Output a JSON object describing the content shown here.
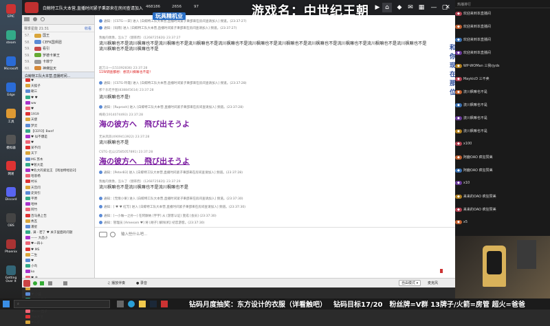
{
  "titlebar": {
    "title": "白鲸特工队大本营,直播时间紧子秉邵来在房间查请加入",
    "likes": "468186",
    "viewers": "2656",
    "extra": "97"
  },
  "overlay_title": "游戏名：中世纪王朝",
  "overlay_banner": "玩具精机业",
  "sidebar": {
    "header": "赛季星能 21:31",
    "header_link": "收看",
    "ranks": [
      {
        "n": "57.",
        "name": "国王"
      },
      {
        "n": "58.",
        "name": "CEFK国师团"
      },
      {
        "n": "59.",
        "name": "看引"
      },
      {
        "n": "59.",
        "name": "罗德卡莱王"
      },
      {
        "n": "59.",
        "name": "卡菲宁"
      },
      {
        "n": "60.",
        "name": "神佛监天"
      }
    ],
    "group": "白鲸特工队大本营,直播时间...",
    "members": [
      "♥",
      "天狐子",
      "朝三",
      "♥ ♥",
      "ww",
      "♥",
      "1919",
      "天使",
      "梦灵",
      "【CEFO】Bwnf",
      "♥ 似不爆是",
      "♥",
      "某不问",
      "天下",
      "MS 苏木",
      "♥爸大是",
      "♥危大的爱远王 【戏伯特经验2】",
      "哈基杨",
      "村长",
      "天宫问",
      "史资引",
      "平原",
      "哈林",
      "阿竹",
      "百马悬上告",
      "秀瓦",
      "潘星",
      ", 满 - 若了 ♥ 关于里面的问题",
      "—— 大品小",
      "♥一四十",
      "♥ MS",
      "二生",
      "♥",
      "小鸟",
      "ko",
      "♥ 主",
      "W(ω･)",
      "(/ ﾟ□ﾟ)",
      "♥ 小猫",
      "灵魂的使者",
      "Jules",
      "♥—— 西子",
      "Yaw大王",
      "♥天庭"
    ]
  },
  "annotation": "和你现在那位",
  "chat": [
    {
      "t": "sys",
      "text": "通知：[CSTG-一宋] 进入 [白鲸特工队大本营,直播时间紧子秉邵来在房间查请加入] 频道。(23:37:27)"
    },
    {
      "t": "sys",
      "text": "通知：[码雨] 进入 [白鲸特工队大本营,直播时间紧子秉邵来在房间查请加入] 频道。(23:37:27)"
    },
    {
      "t": "who",
      "text": "我推的偶像，怎么了（健率而）(126872582§) 23:37:27"
    },
    {
      "t": "txt",
      "text": "流川枫嘛也不是流川枫嘛也不是流川枫嘛也不是流川枫嘛也不是流川枫嘛也不是流川枫嘛也不是流川枫嘛也不是流川枫嘛也不是流川枫嘛也不是流川枫嘛也不是流川枫嘛也不是流川枫嘛也不是流川枫嘛也不是"
    },
    {
      "t": "who",
      "text": "超刀斗一(151092836) 23:37:28"
    },
    {
      "t": "red",
      "text": "11W调查都想：想流川枫嘛也不是！"
    },
    {
      "t": "sys",
      "text": "通知：[CSTG-玲霞] 进入 [白鲸特工队大本营,直播时间紧子秉邵来在房间查请加入] 频道。(23:37:28)"
    },
    {
      "t": "who",
      "text": "那个乐吃手图(838845614) 23:37:28"
    },
    {
      "t": "txt",
      "text": "流川枫嘛也不是!"
    },
    {
      "t": "sys",
      "text": "通知：[Ruprosh] 进入 [白鲸特工队大本营,直播时间紧子秉邵来在房间查请加入] 频道。(23:37:28)"
    },
    {
      "t": "who",
      "text": "梅莉(1914074493) 23:37:28"
    },
    {
      "t": "big",
      "text": "海の彼方へ　飛び出そうよ"
    },
    {
      "t": "who",
      "text": "无米凤凤(4909413922) 23:37:28"
    },
    {
      "t": "txt",
      "text": "流川枫嘛也不是"
    },
    {
      "t": "who",
      "text": "CSTG-北公(2585057891) 23:37:28"
    },
    {
      "t": "big",
      "text": "海の彼方へ　飛び出そうよ"
    },
    {
      "t": "sys",
      "text": "通知：[Peter83] 进入 [白鲸特工队大本营,直播时间紧子秉邵来在房间查请加入] 频道。(23:37:28)"
    },
    {
      "t": "who",
      "text": "我推的偶像，怎么了（健率而）(126872582§) 23:37:29"
    },
    {
      "t": "txt",
      "text": "流川枫嘛也不是流川枫嘛也不是流川枫嘛也不是"
    },
    {
      "t": "sys",
      "text": "通知：[无情小果] 进入 [白鲸特工队大本营,直播时间紧子秉邵来在房间查请加入] 频道。(23:37:30)"
    },
    {
      "t": "sys",
      "text": "通知：[ ♥ ♥ 紅写] 进入 [白鲸特工队大本营,直播时间紧子秉邵来在房间查请加入] 频道。(23:37:30)"
    },
    {
      "t": "sys",
      "text": "通知：[一小做一之孙一] 在阿厮纳 [宇宇] 从 [游客认证] 变成 [会员] (23:37:30)"
    },
    {
      "t": "sys",
      "text": "通知：管理员 [Ameeam ♥] 将 [胡子] 解除[机] 初恋游客。(23:37:30)"
    }
  ],
  "input": {
    "placeholder": "输入些什么吧..."
  },
  "bottombar": {
    "b1": "播放伴奏",
    "b2": "录音",
    "mode": "自由模式",
    "status": "麦克风"
  },
  "right": {
    "header": "热播排行",
    "gifts": [
      {
        "u": "欢迎来到本直播间"
      },
      {
        "u": "欢迎来到本直播间"
      },
      {
        "u": "欢迎来到本直播间"
      },
      {
        "u": "欢迎来到本直播间"
      },
      {
        "u": "WP-WOMan 三我rjyds"
      },
      {
        "u": "MaykicD 三不卖"
      },
      {
        "u": "流川枫嘛也不是"
      },
      {
        "u": "流川枫嘛也不是"
      },
      {
        "u": "流川枫嘛也不是"
      },
      {
        "u": "流川枫嘛也不是"
      },
      {
        "u": "x100"
      },
      {
        "u": "阿鹿OAO 疯狂赞美"
      },
      {
        "u": "阿鹿OAO 疯狂赞美"
      },
      {
        "u": "x10"
      },
      {
        "u": "来来的OAO 疯狂赞美"
      },
      {
        "u": "来来的OAO 疯狂赞美"
      },
      {
        "u": "x5"
      }
    ]
  },
  "ticker": [
    "钻码月度抽奖：东方设计的衣服（详看触吧）",
    "钻码目标17/20",
    "粉丝牌=V群 13牌子/火箭=房管 超火=爸爸"
  ]
}
